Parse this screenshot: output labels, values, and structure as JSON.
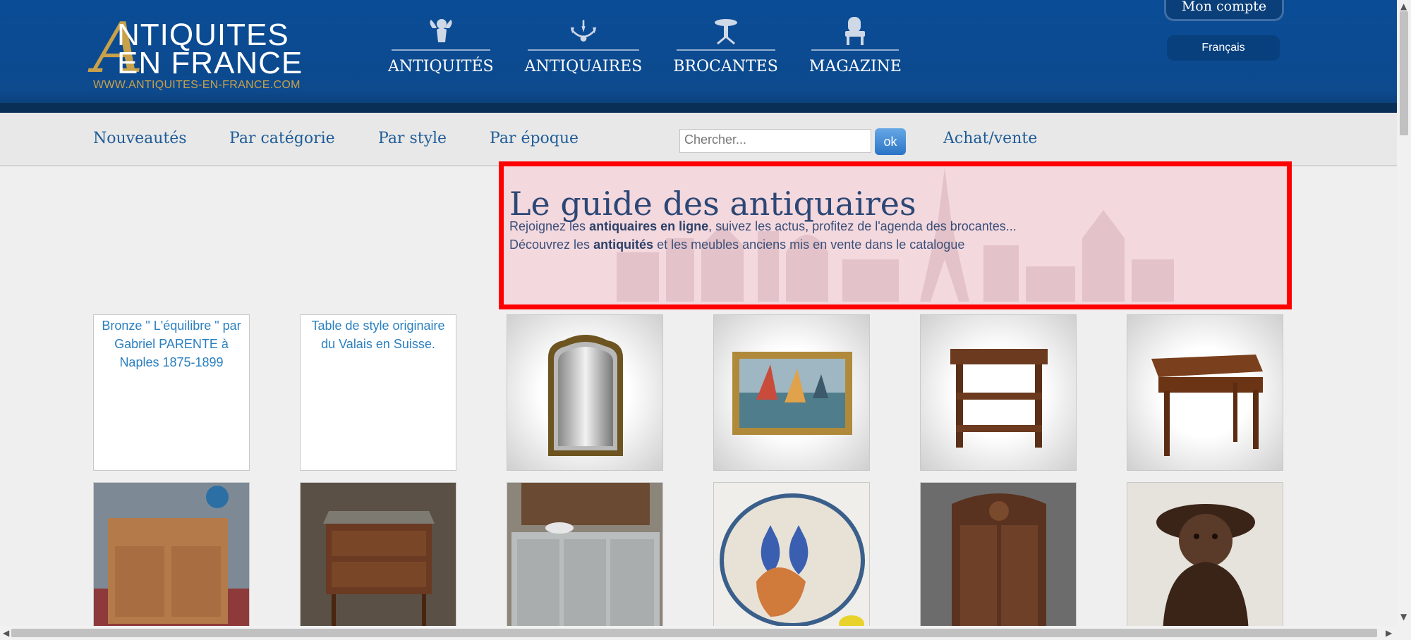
{
  "header": {
    "logo": {
      "big_letter": "A",
      "line1": "NTIQUITES",
      "line2": "EN FRANCE",
      "url": "WWW.ANTIQUITES-EN-FRANCE.COM"
    },
    "nav": [
      {
        "label": "ANTIQUITÉS",
        "icon": "cherub-icon"
      },
      {
        "label": "ANTIQUAIRES",
        "icon": "chandelier-icon"
      },
      {
        "label": "BROCANTES",
        "icon": "pedestal-table-icon"
      },
      {
        "label": "MAGAZINE",
        "icon": "armchair-icon"
      }
    ],
    "account_label": "Mon compte",
    "language_label": "Français"
  },
  "subnav": {
    "links": [
      "Nouveautés",
      "Par catégorie",
      "Par style",
      "Par époque"
    ],
    "search_placeholder": "Chercher...",
    "search_button": "ok",
    "extra_link": "Achat/vente"
  },
  "guide": {
    "title": "Le guide des antiquaires",
    "line1_pre": "Rejoignez les ",
    "line1_bold": "antiquaires en ligne",
    "line1_post": ", suivez les actus, profitez de l'agenda des brocantes...",
    "line2_pre": "Découvrez les ",
    "line2_bold": "antiquités",
    "line2_post": " et les meubles anciens mis en vente dans le catalogue"
  },
  "items_row1": [
    {
      "alt": "Bronze \" L'équilibre \" par Gabriel PARENTE à Naples 1875-1899",
      "broken": true
    },
    {
      "alt": "Table de style originaire du Valais en Suisse.",
      "broken": true
    },
    {
      "image": "gilt-mirror"
    },
    {
      "image": "harbor-painting"
    },
    {
      "image": "wooden-server-table"
    },
    {
      "image": "writing-desk"
    }
  ],
  "items_row2": [
    {
      "image": "wooden-buffet-cabinet"
    },
    {
      "image": "marquetry-commode"
    },
    {
      "image": "painted-buffet"
    },
    {
      "image": "cat-ceramic-plate"
    },
    {
      "image": "carved-armoire"
    },
    {
      "image": "bronze-figure-statue"
    }
  ],
  "colors": {
    "header_blue": "#0d4a8e",
    "gold": "#c9a14a",
    "link_blue": "#1f5c97",
    "highlight_red": "#ff0000"
  }
}
